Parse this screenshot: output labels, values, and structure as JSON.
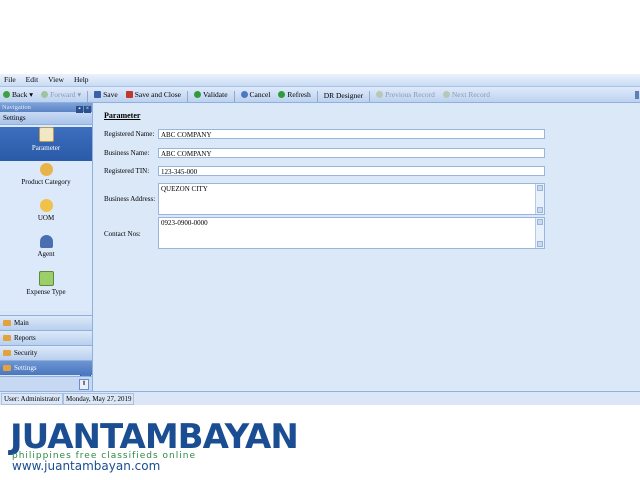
{
  "menu": [
    "File",
    "Edit",
    "View",
    "Help"
  ],
  "toolbar": {
    "back": "Back",
    "forward": "Forward",
    "save": "Save",
    "save_close": "Save and Close",
    "validate": "Validate",
    "cancel": "Cancel",
    "refresh": "Refresh",
    "dr_designer": "DR Designer",
    "previous_record": "Previous Record",
    "next_record": "Next Record"
  },
  "navigation": {
    "title": "Navigation",
    "section": "Settings",
    "items": [
      "Parameter",
      "Product Category",
      "UOM",
      "Agent",
      "Expense Type"
    ],
    "selected": "Parameter",
    "groups": [
      "Main",
      "Reports",
      "Security",
      "Settings"
    ],
    "selected_group": "Settings"
  },
  "form": {
    "title": "Parameter",
    "registered_name_label": "Registered Name:",
    "registered_name": "ABC COMPANY",
    "business_name_label": "Business Name:",
    "business_name": "ABC COMPANY",
    "registered_tin_label": "Registered TIN:",
    "registered_tin": "123-345-000",
    "business_address_label": "Business Address:",
    "business_address": "QUEZON CITY",
    "contact_nos_label": "Contact Nos:",
    "contact_nos": "0923-0900-0000"
  },
  "status": {
    "user": "User: Administrator",
    "date": "Monday, May 27, 2019"
  },
  "watermark": {
    "brand": "JUANTAMBAYAN",
    "tagline": "philippines   free classifieds online",
    "url": "www.juantambayan.com"
  },
  "colors": {
    "accent": "#2a5aa8",
    "panel": "#dbe8f8",
    "toolbar": "#bcd2f0"
  }
}
